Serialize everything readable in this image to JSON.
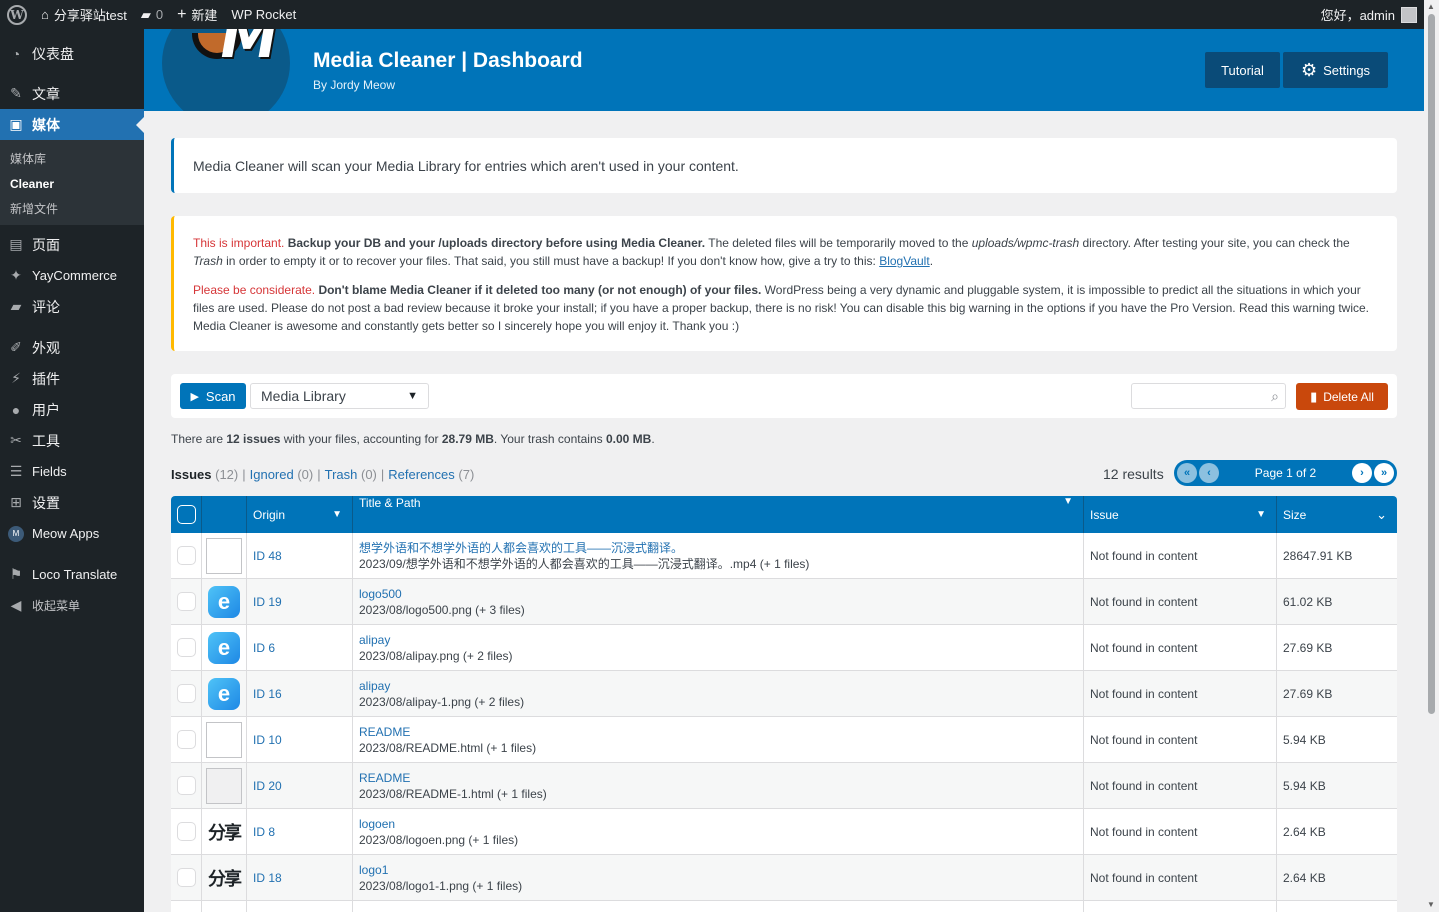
{
  "adminbar": {
    "site": "分享驿站test",
    "comments": "0",
    "new": "新建",
    "rocket": "WP Rocket",
    "greeting": "您好，admin"
  },
  "sidebar": {
    "items": [
      {
        "label": "仪表盘",
        "icon": "dashboard-icon"
      },
      {
        "label": "文章",
        "icon": "pin-icon"
      },
      {
        "label": "媒体",
        "icon": "media-icon"
      },
      {
        "label": "页面",
        "icon": "page-icon"
      },
      {
        "label": "YayCommerce",
        "icon": "yay-icon"
      },
      {
        "label": "评论",
        "icon": "comment-icon"
      },
      {
        "label": "外观",
        "icon": "appearance-icon"
      },
      {
        "label": "插件",
        "icon": "plugin-icon"
      },
      {
        "label": "用户",
        "icon": "user-icon"
      },
      {
        "label": "工具",
        "icon": "tools-icon"
      },
      {
        "label": "Fields",
        "icon": "fields-icon"
      },
      {
        "label": "设置",
        "icon": "settings-icon"
      },
      {
        "label": "Meow Apps",
        "icon": "meow-icon"
      },
      {
        "label": "Loco Translate",
        "icon": "loco-icon"
      },
      {
        "label": "收起菜单",
        "icon": "collapse-icon"
      }
    ],
    "submenu": [
      "媒体库",
      "Cleaner",
      "新增文件"
    ]
  },
  "header": {
    "title": "Media Cleaner | Dashboard",
    "subtitle": "By Jordy Meow",
    "tutorial": "Tutorial",
    "settings": "Settings"
  },
  "intro": "Media Cleaner will scan your Media Library for entries which aren't used in your content.",
  "warning": {
    "p1_red": "This is important.",
    "p1_bold": "Backup your DB and your /uploads directory before using Media Cleaner.",
    "p1_a": "The deleted files will be temporarily moved to the",
    "p1_dir": "uploads/wpmc-trash",
    "p1_b": "directory. After testing your site, you can check the",
    "p1_trash": "Trash",
    "p1_c": "in order to empty it or to recover your files. That said, you still must have a backup! If you don't know how, give a try to this:",
    "p1_link": "BlogVault",
    "p2_red": "Please be considerate.",
    "p2_bold": "Don't blame Media Cleaner if it deleted too many (or not enough) of your files.",
    "p2_text": "WordPress being a very dynamic and pluggable system, it is impossible to predict all the situations in which your files are used. Please do not post a bad review because it broke your install; if you have a proper backup, there is no risk! You can disable this big warning in the options if you have the Pro Version. Read this warning twice. Media Cleaner is awesome and constantly gets better so I sincerely hope you will enjoy it. Thank you :)"
  },
  "toolbar": {
    "scan": "Scan",
    "source": "Media Library",
    "delete_all": "Delete All"
  },
  "summary": {
    "a": "There are",
    "issues": "12 issues",
    "b": "with your files, accounting for",
    "size": "28.79 MB",
    "c": ". Your trash contains",
    "trash": "0.00 MB",
    "d": "."
  },
  "filters": {
    "issues": "Issues",
    "issues_count": "(12)",
    "ignored": "Ignored",
    "ignored_count": "(0)",
    "trash": "Trash",
    "trash_count": "(0)",
    "references": "References",
    "references_count": "(7)",
    "sep": "|"
  },
  "results": "12 results",
  "pager": "Page 1 of 2",
  "table": {
    "headers": {
      "origin": "Origin",
      "title": "Title & Path",
      "issue": "Issue",
      "size": "Size"
    },
    "rows": [
      {
        "id": "ID 48",
        "title": "想学外语和不想学外语的人都会喜欢的工具——沉浸式翻译。",
        "path": "2023/09/想学外语和不想学外语的人都会喜欢的工具——沉浸式翻译。.mp4 (+ 1 files)",
        "issue": "Not found in content",
        "size": "28647.91 KB",
        "thumb": "blank"
      },
      {
        "id": "ID 19",
        "title": "logo500",
        "path": "2023/08/logo500.png (+ 3 files)",
        "issue": "Not found in content",
        "size": "61.02 KB",
        "thumb": "e"
      },
      {
        "id": "ID 6",
        "title": "alipay",
        "path": "2023/08/alipay.png (+ 2 files)",
        "issue": "Not found in content",
        "size": "27.69 KB",
        "thumb": "e"
      },
      {
        "id": "ID 16",
        "title": "alipay",
        "path": "2023/08/alipay-1.png (+ 2 files)",
        "issue": "Not found in content",
        "size": "27.69 KB",
        "thumb": "e"
      },
      {
        "id": "ID 10",
        "title": "README",
        "path": "2023/08/README.html (+ 1 files)",
        "issue": "Not found in content",
        "size": "5.94 KB",
        "thumb": "blank"
      },
      {
        "id": "ID 20",
        "title": "README",
        "path": "2023/08/README-1.html (+ 1 files)",
        "issue": "Not found in content",
        "size": "5.94 KB",
        "thumb": "grey"
      },
      {
        "id": "ID 8",
        "title": "logoen",
        "path": "2023/08/logoen.png (+ 1 files)",
        "issue": "Not found in content",
        "size": "2.64 KB",
        "thumb": "t"
      },
      {
        "id": "ID 18",
        "title": "logo1",
        "path": "2023/08/logo1-1.png (+ 1 files)",
        "issue": "Not found in content",
        "size": "2.64 KB",
        "thumb": "t"
      }
    ]
  },
  "thumb_text": "分享"
}
